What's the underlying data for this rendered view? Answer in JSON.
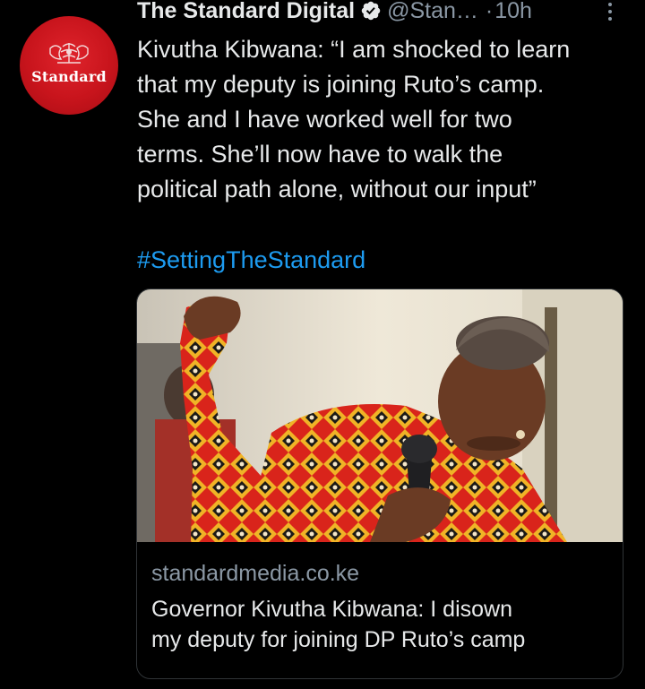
{
  "tweet": {
    "author": {
      "display_name": "The Standard Digital",
      "handle": "@Stan…",
      "avatar_text": "Standard",
      "avatar_icon": "crest-icon",
      "verified_icon": "verified-badge-icon",
      "avatar_color": "#d11a22"
    },
    "separator": "·",
    "time": "10h",
    "more_icon": "more-vertical-icon",
    "text_lines": [
      "Kivutha Kibwana: “I am shocked to learn",
      "that my deputy is joining Ruto’s camp.",
      "She and I have worked well for two",
      "terms. She’ll now have to walk the",
      "political path alone, without our input”"
    ],
    "hashtag": "#SettingTheStandard",
    "link_color": "#1d9bf0"
  },
  "card": {
    "image_description_icon": "article-photo",
    "domain": "standardmedia.co.ke",
    "title_lines": [
      "Governor Kivutha Kibwana: I disown",
      "my deputy for joining DP Ruto’s camp"
    ]
  }
}
